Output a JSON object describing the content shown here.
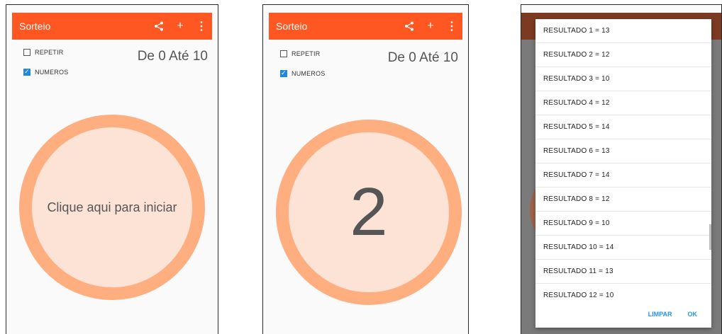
{
  "screens": [
    {
      "appbar": {
        "title": "Sorteio"
      },
      "options": {
        "repeat_label": "REPETIR",
        "repeat_checked": false,
        "numbers_label": "NUMEROS",
        "numbers_checked": true
      },
      "range": "De 0 Até 10",
      "circle_text": "Clique aqui para iniciar"
    },
    {
      "appbar": {
        "title": "Sorteio"
      },
      "options": {
        "repeat_label": "REPETIR",
        "repeat_checked": false,
        "numbers_label": "NUMEROS",
        "numbers_checked": true
      },
      "range": "De 0 Até 10",
      "circle_text": "2"
    },
    {
      "results": [
        "RESULTADO 1 = 13",
        "RESULTADO 2 = 12",
        "RESULTADO 3 = 10",
        "RESULTADO 4 = 12",
        "RESULTADO 5 = 14",
        "RESULTADO 6 = 13",
        "RESULTADO 7 = 14",
        "RESULTADO 8 = 12",
        "RESULTADO 9 = 10",
        "RESULTADO 10 = 14",
        "RESULTADO 11 = 13",
        "RESULTADO 12 = 10"
      ],
      "actions": {
        "clear": "LIMPAR",
        "ok": "OK"
      }
    }
  ],
  "colors": {
    "appbar": "#fe5722",
    "ring": "#ffae80",
    "circle_fill": "#fce3d6",
    "checkbox": "#1e88e5",
    "dialog_button": "#2196f3"
  },
  "icons": [
    "share-icon",
    "plus-icon",
    "more-vert-icon"
  ]
}
